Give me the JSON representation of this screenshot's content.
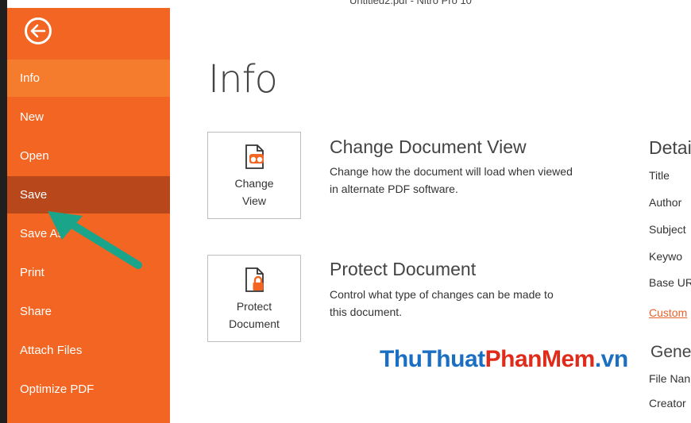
{
  "window": {
    "title": "Untitled2.pdf - Nitro Pro 10"
  },
  "sidebar": {
    "items": [
      {
        "label": "Info"
      },
      {
        "label": "New"
      },
      {
        "label": "Open"
      },
      {
        "label": "Save"
      },
      {
        "label": "Save As"
      },
      {
        "label": "Print"
      },
      {
        "label": "Share"
      },
      {
        "label": "Attach Files"
      },
      {
        "label": "Optimize PDF"
      }
    ]
  },
  "main": {
    "title": "Info",
    "change_view": {
      "tile_line1": "Change",
      "tile_line2": "View",
      "heading": "Change Document View",
      "desc_line1": "Change how the document will load when viewed",
      "desc_line2": "in alternate PDF software."
    },
    "protect": {
      "tile_line1": "Protect",
      "tile_line2": "Document",
      "heading": "Protect Document",
      "desc_line1": "Control what type of changes can be made to",
      "desc_line2": "this document."
    }
  },
  "details": {
    "title": "Detai",
    "props": [
      "Title",
      "Author",
      "Subject",
      "Keywo",
      "Base UR"
    ],
    "custom_link": "Custom",
    "general_title": "Gene",
    "general_props": [
      "File Nan",
      "Creator"
    ]
  },
  "watermark": {
    "part1": "ThuThuat",
    "part2": "PhanMem",
    "part3": ".vn"
  },
  "colors": {
    "sidebar": "#f26522",
    "active_item": "#f47c2c",
    "hover_item": "#b8471c",
    "accent_link": "#e8622c",
    "arrow": "#1aa58a"
  }
}
